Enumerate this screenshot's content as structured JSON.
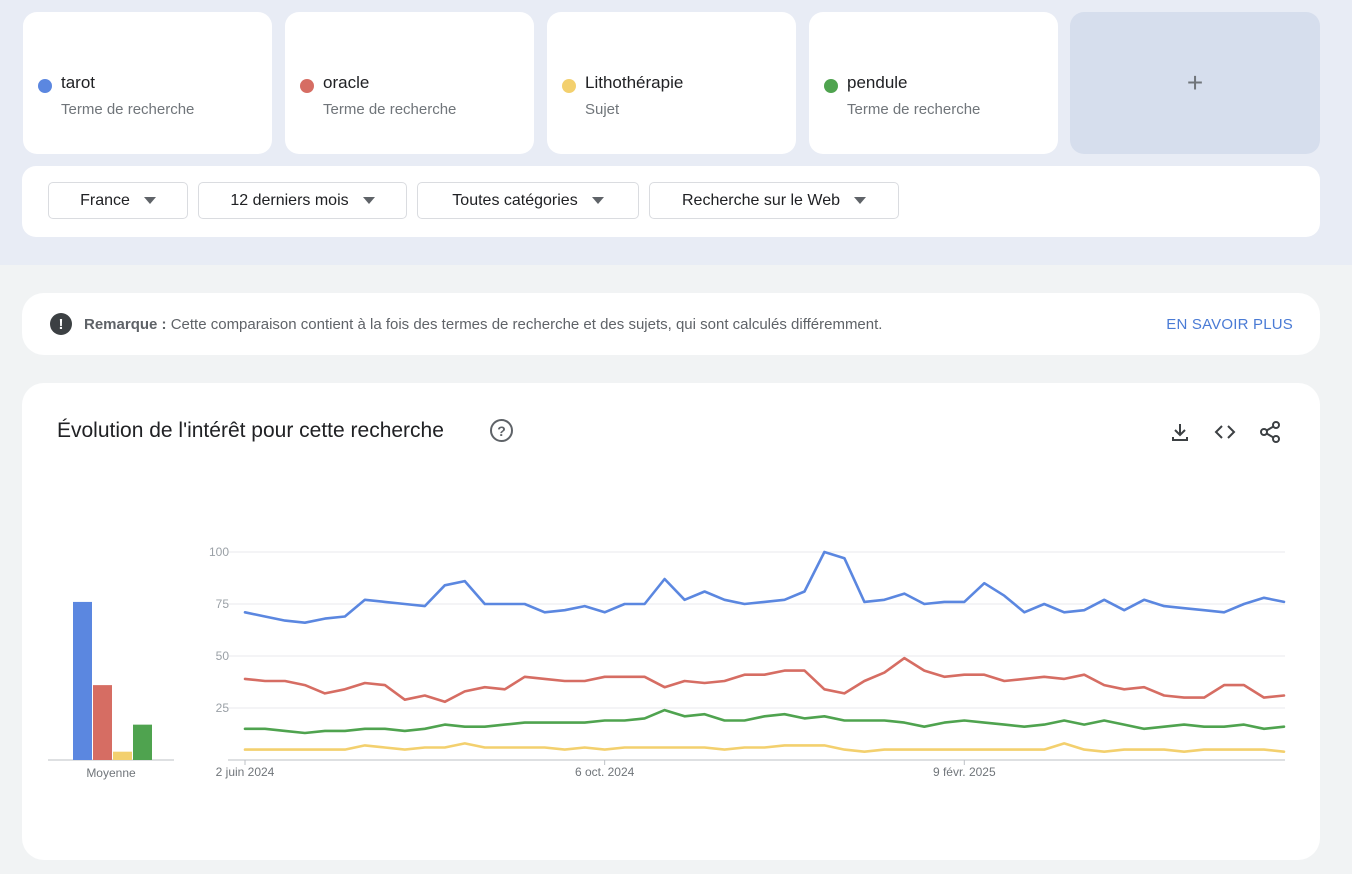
{
  "terms": [
    {
      "name": "tarot",
      "type": "Terme de recherche",
      "color": "#5b87e0"
    },
    {
      "name": "oracle",
      "type": "Terme de recherche",
      "color": "#d66d63"
    },
    {
      "name": "Lithothérapie",
      "type": "Sujet",
      "color": "#f3d06e"
    },
    {
      "name": "pendule",
      "type": "Terme de recherche",
      "color": "#4fa34f"
    }
  ],
  "add_term_label": "+",
  "filters": {
    "region": "France",
    "period": "12 derniers mois",
    "category": "Toutes catégories",
    "search_type": "Recherche sur le Web"
  },
  "notice": {
    "label": "Remarque :",
    "text": "Cette comparaison contient à la fois des termes de recherche et des sujets, qui sont calculés différemment.",
    "link": "EN SAVOIR PLUS"
  },
  "chart": {
    "title": "Évolution de l'intérêt pour cette recherche",
    "help_icon": "question-circle-icon",
    "tools": [
      "download-icon",
      "embed-icon",
      "share-icon"
    ]
  },
  "chart_data": [
    {
      "type": "bar",
      "categories": [
        "tarot",
        "oracle",
        "Lithothérapie",
        "pendule"
      ],
      "values": [
        76,
        36,
        4,
        17
      ],
      "xlabel": "Moyenne",
      "ylim": [
        0,
        100
      ]
    },
    {
      "type": "line",
      "x_tick_labels": [
        "2 juin 2024",
        "6 oct. 2024",
        "9 févr. 2025"
      ],
      "y_ticks": [
        25,
        50,
        75,
        100
      ],
      "ylim": [
        0,
        100
      ],
      "grid": true,
      "series": [
        {
          "name": "tarot",
          "color": "#5b87e0",
          "values": [
            71,
            69,
            67,
            66,
            68,
            69,
            77,
            76,
            75,
            74,
            84,
            86,
            75,
            75,
            75,
            71,
            72,
            74,
            71,
            75,
            75,
            87,
            77,
            81,
            77,
            75,
            76,
            77,
            81,
            100,
            97,
            76,
            77,
            80,
            75,
            76,
            76,
            85,
            79,
            71,
            75,
            71,
            72,
            77,
            72,
            77,
            74,
            73,
            72,
            71,
            75,
            78,
            76
          ]
        },
        {
          "name": "oracle",
          "color": "#d66d63",
          "values": [
            39,
            38,
            38,
            36,
            32,
            34,
            37,
            36,
            29,
            31,
            28,
            33,
            35,
            34,
            40,
            39,
            38,
            38,
            40,
            40,
            40,
            35,
            38,
            37,
            38,
            41,
            41,
            43,
            43,
            34,
            32,
            38,
            42,
            49,
            43,
            40,
            41,
            41,
            38,
            39,
            40,
            39,
            41,
            36,
            34,
            35,
            31,
            30,
            30,
            36,
            36,
            30,
            31
          ]
        },
        {
          "name": "Lithothérapie",
          "color": "#f3d06e",
          "values": [
            5,
            5,
            5,
            5,
            5,
            5,
            7,
            6,
            5,
            6,
            6,
            8,
            6,
            6,
            6,
            6,
            5,
            6,
            5,
            6,
            6,
            6,
            6,
            6,
            5,
            6,
            6,
            7,
            7,
            7,
            5,
            4,
            5,
            5,
            5,
            5,
            5,
            5,
            5,
            5,
            5,
            8,
            5,
            4,
            5,
            5,
            5,
            4,
            5,
            5,
            5,
            5,
            4
          ]
        },
        {
          "name": "pendule",
          "color": "#4fa34f",
          "values": [
            15,
            15,
            14,
            13,
            14,
            14,
            15,
            15,
            14,
            15,
            17,
            16,
            16,
            17,
            18,
            18,
            18,
            18,
            19,
            19,
            20,
            24,
            21,
            22,
            19,
            19,
            21,
            22,
            20,
            21,
            19,
            19,
            19,
            18,
            16,
            18,
            19,
            18,
            17,
            16,
            17,
            19,
            17,
            19,
            17,
            15,
            16,
            17,
            16,
            16,
            17,
            15,
            16
          ]
        }
      ]
    }
  ]
}
